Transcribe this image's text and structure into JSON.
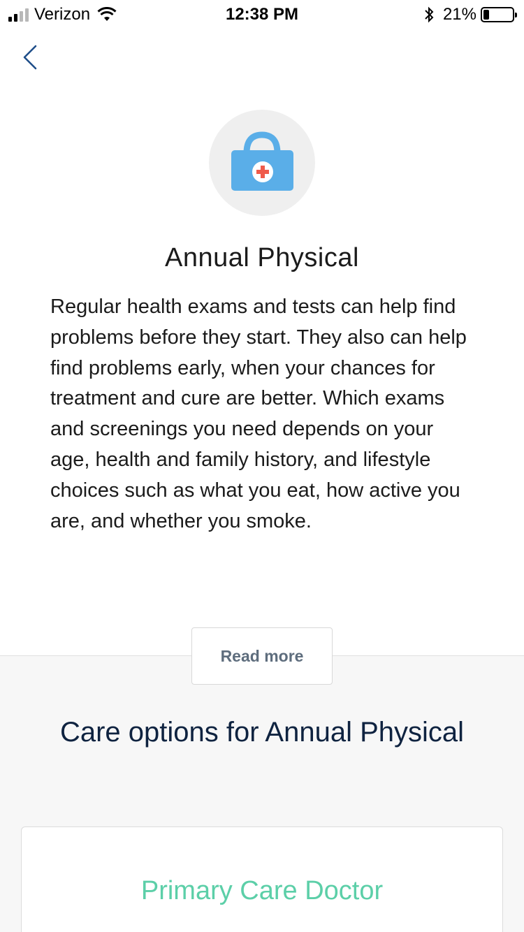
{
  "status_bar": {
    "carrier": "Verizon",
    "time": "12:38 PM",
    "battery_percent": "21%",
    "battery_level": 0.21,
    "signal_bars_active": 2,
    "icons": [
      "signal-icon",
      "wifi-icon",
      "bluetooth-icon",
      "battery-icon"
    ]
  },
  "nav": {
    "back_icon": "chevron-left-icon"
  },
  "hero": {
    "icon": "medical-kit-icon",
    "title": "Annual Physical",
    "description": "Regular health exams and tests can help find problems before they start. They also can help find problems early, when your chances for treatment and cure are better. Which exams and screenings you need depends on your age, health and family history, and lifestyle choices such as what you eat, how active you are, and whether you smoke."
  },
  "read_more_label": "Read more",
  "care_options": {
    "title": "Care options for Annual Physical",
    "items": [
      {
        "label": "Primary Care Doctor"
      }
    ]
  },
  "colors": {
    "accent_green": "#5ccfa8",
    "heading_navy": "#0f2340",
    "back_blue": "#1f4f8a",
    "kit_blue": "#5aaee8",
    "cross_red": "#ef5b4b"
  }
}
